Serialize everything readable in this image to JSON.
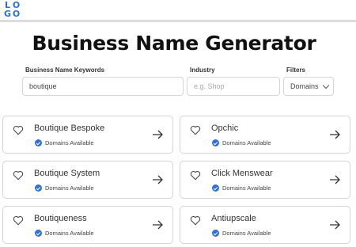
{
  "header": {
    "logo_letters": [
      "L",
      "O",
      "G",
      "O"
    ]
  },
  "page": {
    "title": "Business Name Generator"
  },
  "form": {
    "keywords_label": "Business Name Keywords",
    "keywords_value": "boutique",
    "industry_label": "Industry",
    "industry_placeholder": "e.g. Shop",
    "filters_label": "Filters",
    "filters_value": "Domains"
  },
  "results": [
    {
      "name": "Boutique Bespoke",
      "status": "Domains Available"
    },
    {
      "name": "Opchic",
      "status": "Domains Available"
    },
    {
      "name": "Boutique System",
      "status": "Domains Available"
    },
    {
      "name": "Click Menswear",
      "status": "Domains Available"
    },
    {
      "name": "Boutiqueness",
      "status": "Domains Available"
    },
    {
      "name": "Antiupscale",
      "status": "Domains Available"
    }
  ],
  "colors": {
    "accent": "#2f6fd6"
  }
}
